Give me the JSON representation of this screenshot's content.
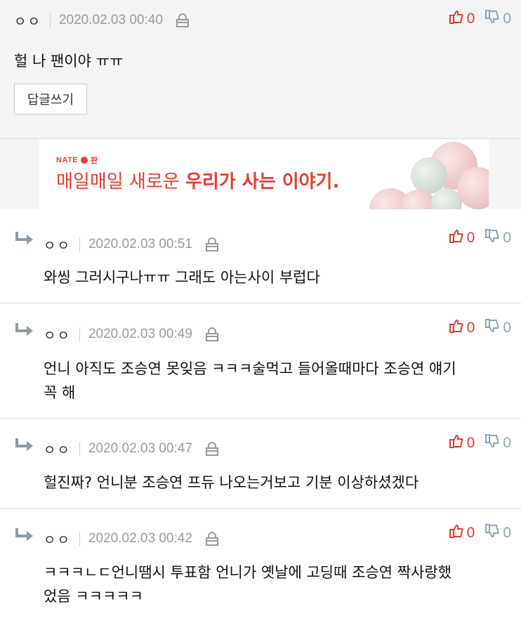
{
  "top_comment": {
    "author": "ㅇㅇ",
    "date": "2020.02.03 00:40",
    "text": "헐 나 팬이야 ㅠㅠ",
    "reply_label": "답글쓰기",
    "up": "0",
    "down": "0"
  },
  "banner": {
    "brand": "NATE",
    "brand_sub": "판",
    "slogan_plain": "매일매일 새로운 ",
    "slogan_bold": "우리가 사는 이야기.",
    "accent": "#e63d2f"
  },
  "replies": [
    {
      "author": "ㅇㅇ",
      "date": "2020.02.03 00:51",
      "text": "와씽 그러시구나ㅠㅠ 그래도 아는사이 부럽다",
      "up": "0",
      "down": "0"
    },
    {
      "author": "ㅇㅇ",
      "date": "2020.02.03 00:49",
      "text": "언니 아직도 조승연 못잊음 ㅋㅋㅋ술먹고 들어올때마다 조승연 얘기",
      "text2": "꼭 해",
      "up": "0",
      "down": "0"
    },
    {
      "author": "ㅇㅇ",
      "date": "2020.02.03 00:47",
      "text": "헐진짜? 언니분 조승연 프듀 나오는거보고 기분 이상하셨겠다",
      "up": "0",
      "down": "0"
    },
    {
      "author": "ㅇㅇ",
      "date": "2020.02.03 00:42",
      "text": "ㅋㅋㅋㄴㄷ언니땜시 투표함 언니가 옛날에 고딩때 조승연 짝사랑했",
      "text2": "었음 ㅋㅋㅋㅋㅋ",
      "up": "0",
      "down": "0"
    }
  ],
  "colors": {
    "up": "#e23a2f",
    "down": "#8aa6b8",
    "date": "#9a9a9a"
  },
  "icons": {
    "reply": "reply-arrow-icon",
    "lock": "lock-icon",
    "up": "thumbs-up-icon",
    "down": "thumbs-down-icon"
  }
}
